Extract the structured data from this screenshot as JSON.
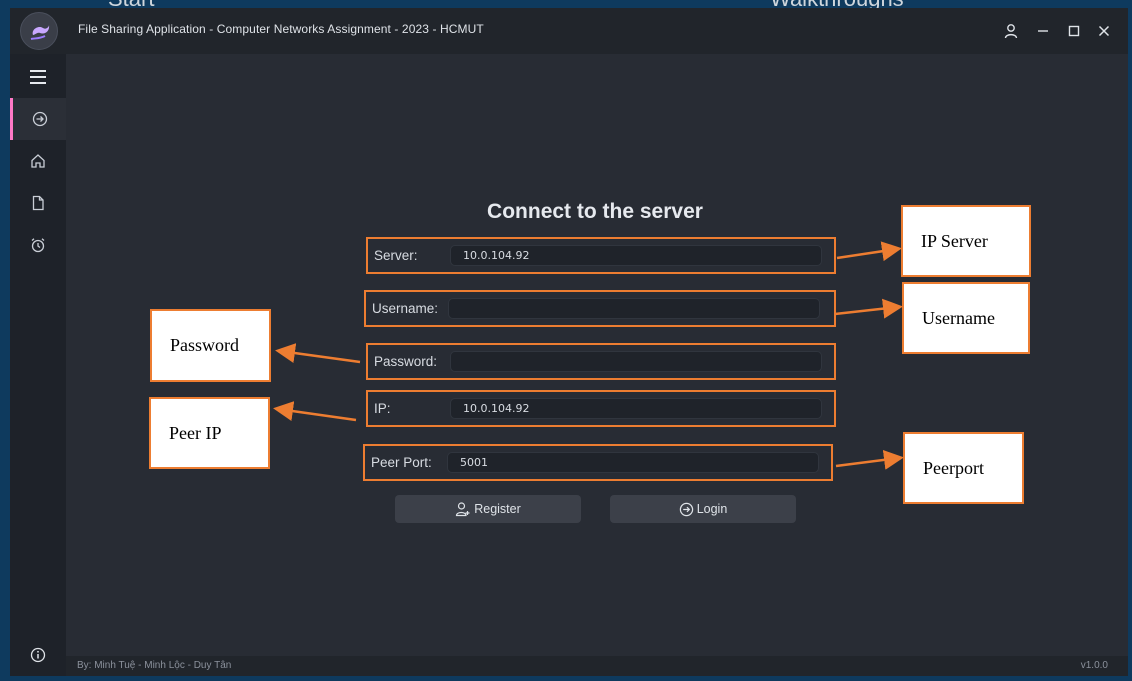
{
  "window": {
    "title": "File Sharing Application - Computer Networks Assignment - 2023 - HCMUT"
  },
  "desktop": {
    "frag_start": "Start",
    "frag_walk": "Walkthroughs"
  },
  "main": {
    "heading": "Connect to the server",
    "fields": [
      {
        "label": "Server:",
        "value": "10.0.104.92"
      },
      {
        "label": "Username:",
        "value": ""
      },
      {
        "label": "Password:",
        "value": ""
      },
      {
        "label": "IP:",
        "value": "10.0.104.92"
      },
      {
        "label": "Peer Port:",
        "value": "5001"
      }
    ],
    "register_label": "Register",
    "login_label": "Login"
  },
  "footer": {
    "credits": "By: Minh Tuệ - Minh Lộc - Duy Tân",
    "version": "v1.0.0"
  },
  "annotations": {
    "ip_server": "IP Server",
    "username": "Username",
    "password": "Password",
    "peer_ip": "Peer IP",
    "peerport": "Peerport"
  },
  "colors": {
    "accent": "#ff79c6",
    "annotation_border": "#ed7d31",
    "background": "#282c34"
  },
  "icons": [
    "menu-icon",
    "login-arrow-icon",
    "home-icon",
    "file-icon",
    "alarm-clock-icon",
    "info-icon",
    "user-icon",
    "minimize-icon",
    "maximize-icon",
    "close-icon",
    "user-add-icon"
  ]
}
